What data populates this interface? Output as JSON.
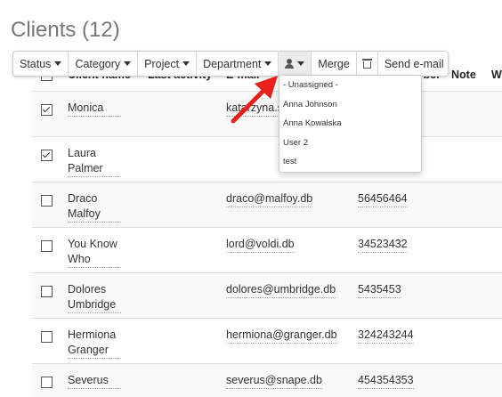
{
  "page": {
    "title": "Clients (12)"
  },
  "toolbar": {
    "status": "Status",
    "category": "Category",
    "project": "Project",
    "department": "Department",
    "merge": "Merge",
    "send_email": "Send e-mail"
  },
  "dropdown": {
    "items": [
      "- Unassigned -",
      "Anna Johnson",
      "Anna Kowalska",
      "User 2",
      "test"
    ]
  },
  "table": {
    "headers": {
      "name": "Client name",
      "activity": "Last activity",
      "email": "E-mail",
      "phone": "Phone number",
      "phone_visible": "ber",
      "note": "Note",
      "extra": "We"
    },
    "rows": [
      {
        "checked": true,
        "name": "Monica",
        "email": "katarzyna.s",
        "phone": ""
      },
      {
        "checked": true,
        "name": "Laura Palmer",
        "email": "",
        "phone": ""
      },
      {
        "checked": false,
        "name": "Draco Malfoy",
        "email": "draco@malfoy.db",
        "phone": "56456464"
      },
      {
        "checked": false,
        "name": "You Know Who",
        "email": "lord@voldi.db",
        "phone": "34523432"
      },
      {
        "checked": false,
        "name": "Dolores Umbridge",
        "email": "dolores@umbridge.db",
        "phone": "5435453"
      },
      {
        "checked": false,
        "name": "Hermiona Granger",
        "email": "hermiona@granger.db",
        "phone": "324243244"
      },
      {
        "checked": false,
        "name": "Severus",
        "email": "severus@snape.db",
        "phone": "454354353"
      }
    ]
  }
}
